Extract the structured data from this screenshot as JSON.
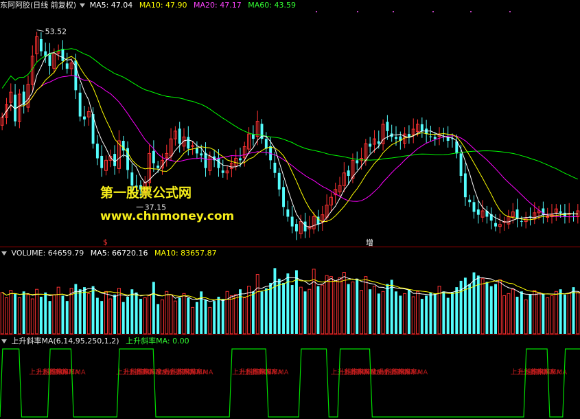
{
  "price_header": {
    "title": "东阿阿胶(日线 前复权)",
    "ma5": "MA5: 47.04",
    "ma10": "MA10: 47.90",
    "ma20": "MA20: 47.17",
    "ma60": "MA60: 43.59"
  },
  "watermark": {
    "line1": "第一股票公式网",
    "line2": "www.chnmoney.com"
  },
  "price_annotations": {
    "high": "53.52",
    "low": "37.15",
    "marker_s": "$",
    "marker_zeng": "增"
  },
  "volume_header": {
    "volume": "VOLUME: 64659.79",
    "ma5": "MA5: 66720.16",
    "ma10": "MA10: 83657.87"
  },
  "indicator_header": {
    "name": "上升斜率MA(6,14,95,250,1,2)",
    "value": "上升斜率MA: 0.00"
  },
  "indicator_label": "上升斜率MA",
  "colors": {
    "up": "#ff3232",
    "down": "#54fcfc",
    "ma5": "#ffffff",
    "ma10": "#ffff00",
    "ma20": "#ff00ff",
    "ma60": "#00ff00",
    "indicator": "#00e000",
    "separator": "#a00000"
  },
  "series": {
    "closes": [
      45.2,
      46.5,
      47.8,
      44.8,
      47.6,
      46.5,
      48.6,
      51.5,
      53.5,
      52.0,
      51.5,
      50.5,
      51.8,
      52.0,
      51.0,
      50.2,
      50.8,
      48.0,
      45.3,
      45.0,
      45.8,
      42.5,
      41.0,
      40.0,
      40.8,
      41.2,
      40.2,
      42.8,
      41.8,
      39.8,
      38.2,
      38.0,
      37.8,
      38.5,
      41.5,
      40.5,
      40.0,
      40.8,
      41.5,
      43.0,
      43.8,
      42.5,
      43.2,
      42.0,
      42.3,
      41.5,
      41.3,
      40.0,
      41.2,
      40.8,
      40.0,
      39.5,
      39.7,
      40.5,
      41.0,
      40.8,
      42.2,
      43.5,
      43.0,
      44.8,
      43.0,
      42.0,
      40.8,
      39.5,
      37.8,
      36.0,
      35.0,
      34.0,
      33.5,
      34.5,
      33.5,
      34.0,
      35.0,
      34.2,
      35.2,
      36.2,
      37.0,
      37.8,
      38.2,
      39.5,
      39.2,
      40.8,
      40.5,
      41.0,
      42.5,
      42.2,
      43.0,
      42.5,
      44.5,
      43.8,
      43.2,
      43.0,
      42.8,
      43.5,
      43.2,
      44.0,
      44.5,
      43.8,
      43.5,
      43.2,
      43.0,
      43.5,
      43.2,
      42.8,
      43.0,
      41.5,
      39.2,
      37.0,
      36.5,
      35.5,
      35.2,
      35.6,
      35.0,
      34.6,
      34.0,
      34.2,
      34.5,
      35.0,
      35.5,
      34.8,
      34.5,
      34.8,
      35.0,
      35.4,
      35.6,
      35.2,
      35.0,
      35.2,
      35.8,
      35.4,
      35.0,
      35.3,
      35.0,
      35.6
    ],
    "volumes": [
      39,
      34,
      41,
      38,
      34,
      40,
      37,
      33,
      42,
      35,
      39,
      31,
      37,
      44,
      36,
      31,
      43,
      47,
      42,
      44,
      38,
      45,
      34,
      31,
      40,
      33,
      37,
      43,
      30,
      35,
      42,
      39,
      33,
      34,
      36,
      49,
      28,
      32,
      40,
      37,
      31,
      34,
      38,
      34,
      25,
      30,
      40,
      32,
      25,
      31,
      35,
      33,
      40,
      36,
      37,
      42,
      34,
      45,
      40,
      56,
      40,
      43,
      48,
      62,
      52,
      48,
      57,
      46,
      60,
      44,
      40,
      42,
      61,
      45,
      46,
      55,
      54,
      50,
      53,
      58,
      47,
      49,
      52,
      41,
      54,
      42,
      45,
      38,
      40,
      47,
      51,
      40,
      36,
      38,
      42,
      35,
      40,
      33,
      36,
      39,
      38,
      45,
      40,
      34,
      39,
      44,
      50,
      53,
      47,
      58,
      55,
      52,
      49,
      45,
      47,
      51,
      36,
      38,
      42,
      35,
      40,
      32,
      37,
      41,
      39,
      38,
      34,
      36,
      40,
      42,
      37,
      38,
      44,
      39,
      35,
      37,
      33,
      36
    ],
    "indicator_high": [
      [
        0,
        4
      ],
      [
        11,
        16
      ],
      [
        27,
        35
      ],
      [
        53,
        61
      ],
      [
        69,
        75
      ],
      [
        78,
        85
      ],
      [
        121,
        126
      ],
      [
        130,
        134
      ]
    ],
    "indicator_label_positions": [
      0.05,
      0.2,
      0.27,
      0.4,
      0.57,
      0.64,
      0.88
    ]
  }
}
